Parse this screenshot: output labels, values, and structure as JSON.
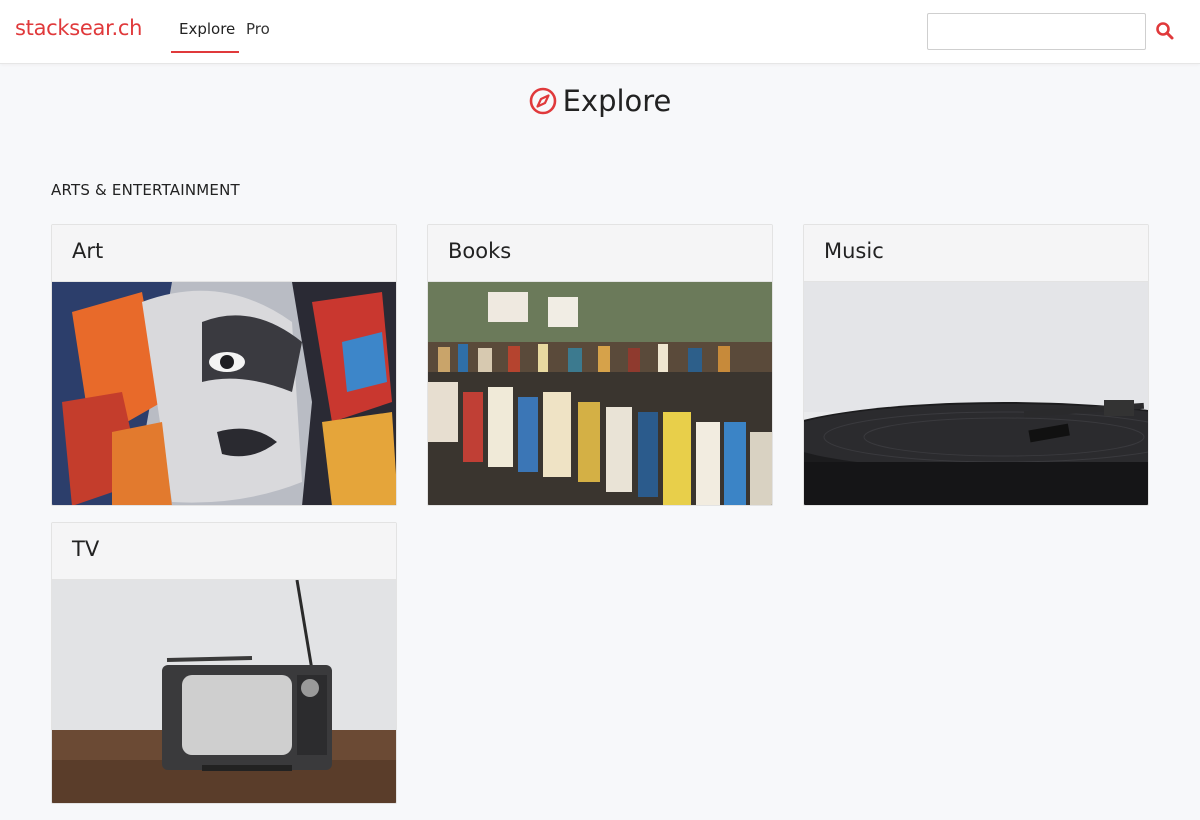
{
  "header": {
    "logo": "stacksear.ch",
    "nav": [
      {
        "label": "Explore",
        "active": true
      },
      {
        "label": "Pro",
        "active": false
      }
    ],
    "search": {
      "value": "",
      "placeholder": "",
      "icon": "search-icon"
    },
    "accent_color": "#e0393b"
  },
  "main": {
    "title": "Explore",
    "title_icon": "compass-icon",
    "section": "ARTS & ENTERTAINMENT",
    "cards": [
      {
        "label": "Art",
        "image": "street-art-mural-woman-face"
      },
      {
        "label": "Books",
        "image": "stacks-of-books-on-tables"
      },
      {
        "label": "Music",
        "image": "vinyl-record-turntable"
      },
      {
        "label": "TV",
        "image": "vintage-portable-tv-set"
      }
    ]
  }
}
